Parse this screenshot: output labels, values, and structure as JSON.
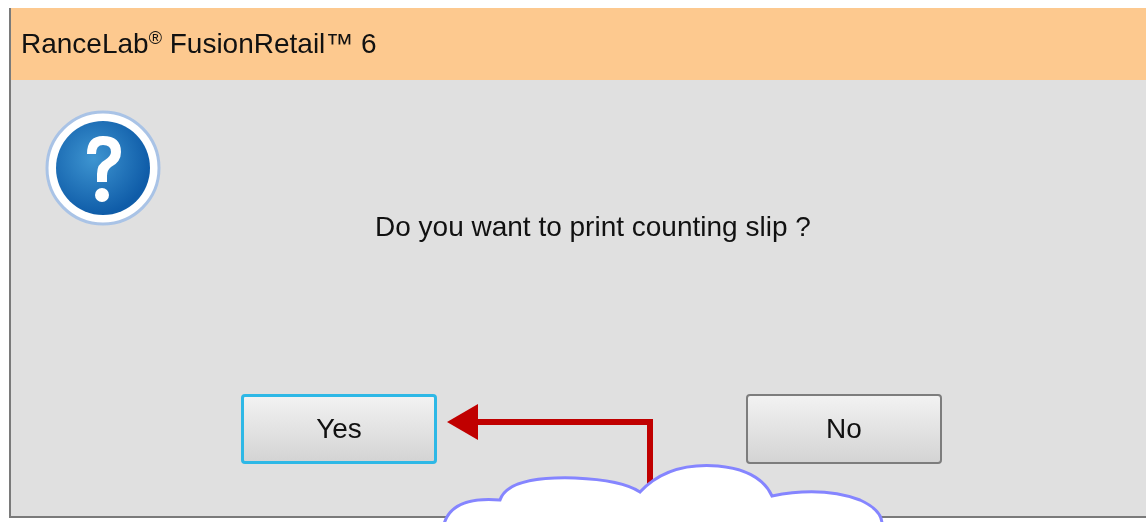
{
  "window": {
    "title": "RanceLab$^{®}$ FusionRetail™ 6"
  },
  "message": "Do you want to print counting slip ?",
  "buttons": [
    {
      "label": "Yes",
      "selected": true
    },
    {
      "label": "No",
      "selected": false
    }
  ]
}
